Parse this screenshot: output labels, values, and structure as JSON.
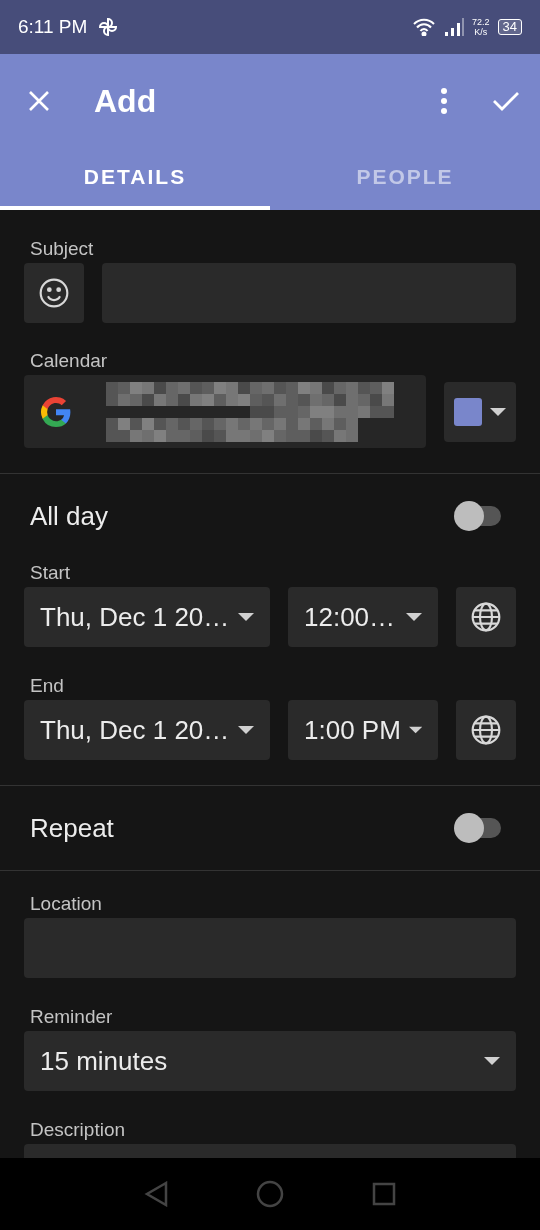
{
  "status_bar": {
    "time": "6:11 PM",
    "net_speed": "72.2",
    "net_unit": "K/s",
    "battery": "34"
  },
  "app_bar": {
    "title": "Add"
  },
  "tabs": [
    {
      "label": "DETAILS",
      "selected": true
    },
    {
      "label": "PEOPLE",
      "selected": false
    }
  ],
  "subject": {
    "label": "Subject"
  },
  "calendar": {
    "label": "Calendar",
    "color": "#7986cb"
  },
  "all_day": {
    "label": "All day",
    "on": false
  },
  "start": {
    "label": "Start",
    "date": "Thu, Dec 1 20…",
    "time": "12:00…"
  },
  "end": {
    "label": "End",
    "date": "Thu, Dec 1 20…",
    "time": "1:00 PM"
  },
  "repeat": {
    "label": "Repeat",
    "on": false
  },
  "location": {
    "label": "Location"
  },
  "reminder": {
    "label": "Reminder",
    "value": "15 minutes"
  },
  "description": {
    "label": "Description"
  }
}
